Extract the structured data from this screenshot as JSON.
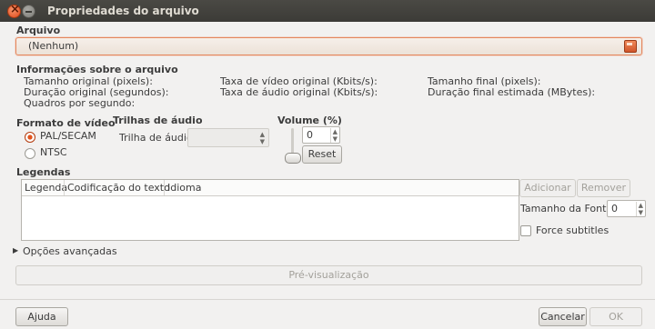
{
  "window": {
    "title": "Propriedades do arquivo"
  },
  "file": {
    "section_label": "Arquivo",
    "value": "(Nenhum)",
    "icon": "document-open-icon"
  },
  "info": {
    "heading": "Informações sobre o arquivo",
    "col1": [
      "Tamanho original (pixels):",
      "Duração original (segundos):",
      "Quadros por segundo:"
    ],
    "col2": [
      "Taxa de vídeo original (Kbits/s):",
      "Taxa de áudio original (Kbits/s):"
    ],
    "col3": [
      "Tamanho final (pixels):",
      "Duração final estimada (MBytes):"
    ]
  },
  "video_format": {
    "heading": "Formato de vídeo",
    "options": [
      "PAL/SECAM",
      "NTSC"
    ],
    "selected": "PAL/SECAM"
  },
  "audio_tracks": {
    "heading": "Trilhas de áudio",
    "track_label": "Trilha de áudio:",
    "track_value": ""
  },
  "volume": {
    "heading": "Volume (%)",
    "value": "0",
    "reset_label": "Reset"
  },
  "subtitles": {
    "heading": "Legendas",
    "columns": [
      "Legenda",
      "Codificação do texto",
      "Idioma"
    ],
    "rows": [],
    "add_label": "Adicionar",
    "remove_label": "Remover",
    "font_size_label": "Tamanho da Fonte:",
    "font_size_value": "0",
    "force_label": "Force subtitles",
    "force_checked": false
  },
  "advanced": {
    "label": "Opções avançadas"
  },
  "preview": {
    "label": "Pré-visualização"
  },
  "footer": {
    "help_label": "Ajuda",
    "cancel_label": "Cancelar",
    "ok_label": "OK"
  },
  "colors": {
    "accent": "#e2541c",
    "titlebar": "#3c3b37"
  }
}
